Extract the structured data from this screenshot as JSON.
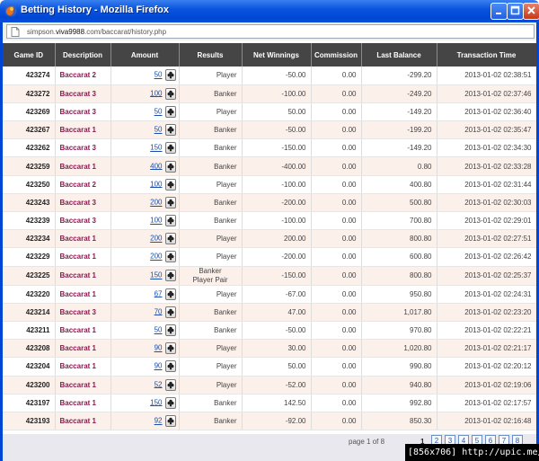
{
  "window": {
    "title": "Betting History - Mozilla Firefox",
    "url_prefix": "simpson.",
    "url_domain": "viva9988",
    "url_suffix": ".com/baccarat/history.php"
  },
  "table": {
    "headers": [
      "Game ID",
      "Description",
      "Amount",
      "Results",
      "Net Winnings",
      "Commission",
      "Last Balance",
      "Transaction Time"
    ],
    "rows": [
      {
        "id": "423274",
        "desc": "Baccarat 2",
        "amount": "50",
        "result": "Player",
        "net": "-50.00",
        "comm": "0.00",
        "bal": "-299.20",
        "time": "2013-01-02 02:38:51"
      },
      {
        "id": "423272",
        "desc": "Baccarat 3",
        "amount": "100",
        "result": "Banker",
        "net": "-100.00",
        "comm": "0.00",
        "bal": "-249.20",
        "time": "2013-01-02 02:37:46"
      },
      {
        "id": "423269",
        "desc": "Baccarat 3",
        "amount": "50",
        "result": "Player",
        "net": "50.00",
        "comm": "0.00",
        "bal": "-149.20",
        "time": "2013-01-02 02:36:40"
      },
      {
        "id": "423267",
        "desc": "Baccarat 1",
        "amount": "50",
        "result": "Banker",
        "net": "-50.00",
        "comm": "0.00",
        "bal": "-199.20",
        "time": "2013-01-02 02:35:47"
      },
      {
        "id": "423262",
        "desc": "Baccarat 3",
        "amount": "150",
        "result": "Banker",
        "net": "-150.00",
        "comm": "0.00",
        "bal": "-149.20",
        "time": "2013-01-02 02:34:30"
      },
      {
        "id": "423259",
        "desc": "Baccarat 1",
        "amount": "400",
        "result": "Banker",
        "net": "-400.00",
        "comm": "0.00",
        "bal": "0.80",
        "time": "2013-01-02 02:33:28"
      },
      {
        "id": "423250",
        "desc": "Baccarat 2",
        "amount": "100",
        "result": "Player",
        "net": "-100.00",
        "comm": "0.00",
        "bal": "400.80",
        "time": "2013-01-02 02:31:44"
      },
      {
        "id": "423243",
        "desc": "Baccarat 3",
        "amount": "200",
        "result": "Banker",
        "net": "-200.00",
        "comm": "0.00",
        "bal": "500.80",
        "time": "2013-01-02 02:30:03"
      },
      {
        "id": "423239",
        "desc": "Baccarat 3",
        "amount": "100",
        "result": "Banker",
        "net": "-100.00",
        "comm": "0.00",
        "bal": "700.80",
        "time": "2013-01-02 02:29:01"
      },
      {
        "id": "423234",
        "desc": "Baccarat 1",
        "amount": "200",
        "result": "Player",
        "net": "200.00",
        "comm": "0.00",
        "bal": "800.80",
        "time": "2013-01-02 02:27:51"
      },
      {
        "id": "423229",
        "desc": "Baccarat 1",
        "amount": "200",
        "result": "Player",
        "net": "-200.00",
        "comm": "0.00",
        "bal": "600.80",
        "time": "2013-01-02 02:26:42"
      },
      {
        "id": "423225",
        "desc": "Baccarat 1",
        "amount": "150",
        "result": "Banker",
        "result2": "Player Pair",
        "net": "-150.00",
        "comm": "0.00",
        "bal": "800.80",
        "time": "2013-01-02 02:25:37"
      },
      {
        "id": "423220",
        "desc": "Baccarat 1",
        "amount": "67",
        "result": "Player",
        "net": "-67.00",
        "comm": "0.00",
        "bal": "950.80",
        "time": "2013-01-02 02:24:31"
      },
      {
        "id": "423214",
        "desc": "Baccarat 3",
        "amount": "70",
        "result": "Banker",
        "net": "47.00",
        "comm": "0.00",
        "bal": "1,017.80",
        "time": "2013-01-02 02:23:20"
      },
      {
        "id": "423211",
        "desc": "Baccarat 1",
        "amount": "50",
        "result": "Banker",
        "net": "-50.00",
        "comm": "0.00",
        "bal": "970.80",
        "time": "2013-01-02 02:22:21"
      },
      {
        "id": "423208",
        "desc": "Baccarat 1",
        "amount": "90",
        "result": "Player",
        "net": "30.00",
        "comm": "0.00",
        "bal": "1,020.80",
        "time": "2013-01-02 02:21:17"
      },
      {
        "id": "423204",
        "desc": "Baccarat 1",
        "amount": "90",
        "result": "Player",
        "net": "50.00",
        "comm": "0.00",
        "bal": "990.80",
        "time": "2013-01-02 02:20:12"
      },
      {
        "id": "423200",
        "desc": "Baccarat 1",
        "amount": "52",
        "result": "Player",
        "net": "-52.00",
        "comm": "0.00",
        "bal": "940.80",
        "time": "2013-01-02 02:19:06"
      },
      {
        "id": "423197",
        "desc": "Baccarat 1",
        "amount": "150",
        "result": "Banker",
        "net": "142.50",
        "comm": "0.00",
        "bal": "992.80",
        "time": "2013-01-02 02:17:57"
      },
      {
        "id": "423193",
        "desc": "Baccarat 1",
        "amount": "92",
        "result": "Banker",
        "net": "-92.00",
        "comm": "0.00",
        "bal": "850.30",
        "time": "2013-01-02 02:16:48"
      }
    ]
  },
  "pager": {
    "text": "page 1 of 8",
    "current": "1",
    "pages": [
      "2",
      "3",
      "4",
      "5",
      "6",
      "7",
      "8"
    ]
  },
  "watermark": "[856x706] http://upic.me/",
  "colors": {
    "header_bg": "#454545",
    "row_alt": "#fcf0ea",
    "desc_text": "#8a1a52",
    "link": "#1a4ea8",
    "titlebar": "#0046d6"
  },
  "icons": {
    "browser": "firefox-icon",
    "page": "page-icon",
    "card": "card-suit-icon"
  }
}
